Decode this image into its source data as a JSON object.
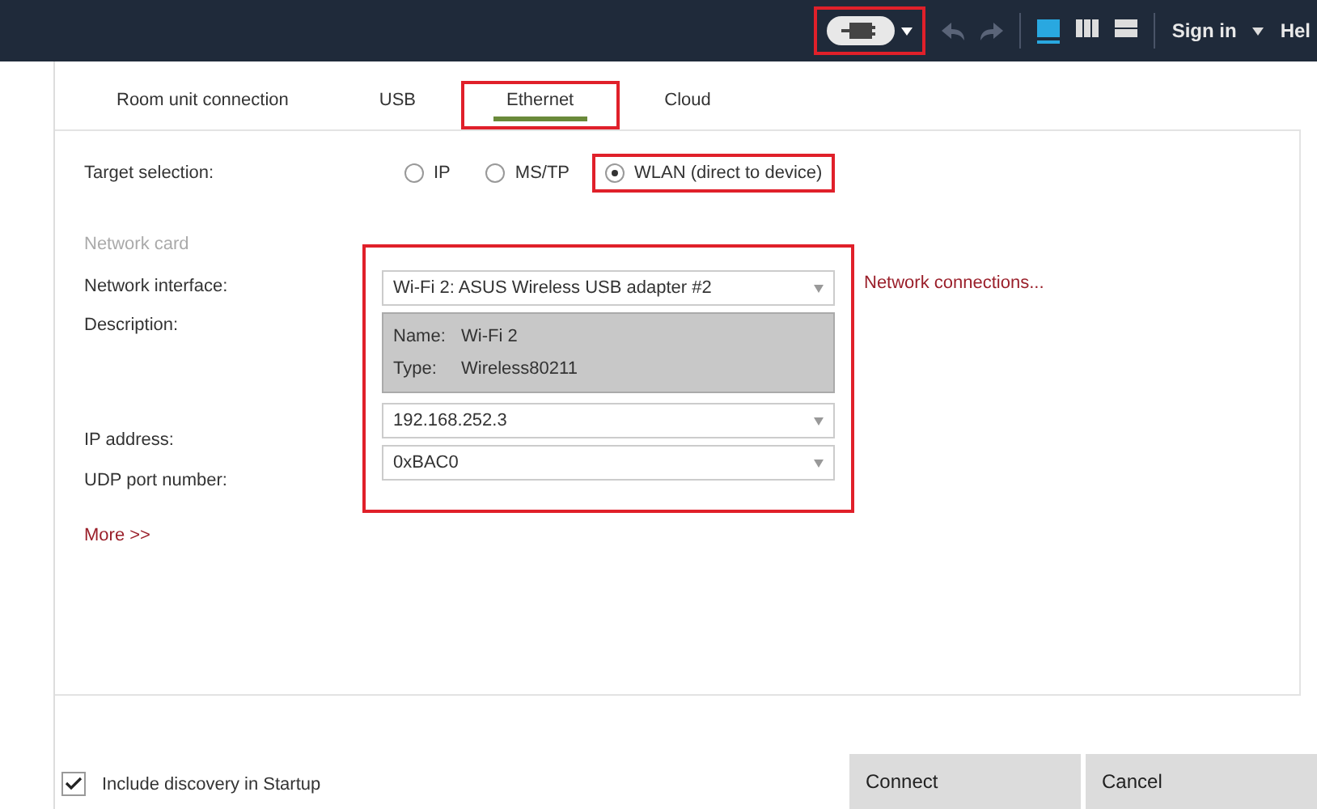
{
  "toolbar": {
    "connect_toggle": {
      "highlighted": true
    },
    "view_modes": [
      {
        "kind": "single",
        "selected": true
      },
      {
        "kind": "columns",
        "selected": false
      },
      {
        "kind": "rows",
        "selected": false
      }
    ],
    "sign_in": "Sign in",
    "help": "Hel"
  },
  "tabs": [
    {
      "label": "Room unit connection",
      "selected": false,
      "highlighted": false
    },
    {
      "label": "USB",
      "selected": false,
      "highlighted": false
    },
    {
      "label": "Ethernet",
      "selected": true,
      "highlighted": true
    },
    {
      "label": "Cloud",
      "selected": false,
      "highlighted": false
    }
  ],
  "target_selection": {
    "label": "Target selection:",
    "options": [
      {
        "label": "IP",
        "selected": false,
        "highlighted": false
      },
      {
        "label": "MS/TP",
        "selected": false,
        "highlighted": false
      },
      {
        "label": "WLAN (direct to device)",
        "selected": true,
        "highlighted": true
      }
    ]
  },
  "network_card": {
    "heading": "Network card",
    "highlighted": true,
    "interface": {
      "label": "Network interface:",
      "value": "Wi-Fi 2: ASUS Wireless USB adapter #2"
    },
    "link": "Network connections...",
    "description": {
      "label": "Description:",
      "lines": [
        {
          "key": "Name:",
          "value": "Wi-Fi 2"
        },
        {
          "key": "Type:",
          "value": "Wireless80211"
        }
      ]
    },
    "ip": {
      "label": "IP address:",
      "value": "192.168.252.3"
    },
    "udp": {
      "label": "UDP port number:",
      "value": "0xBAC0"
    }
  },
  "more": "More >>",
  "include_discovery": {
    "label": "Include discovery in Startup",
    "checked": true
  },
  "buttons": [
    "Connect",
    "Cancel"
  ]
}
